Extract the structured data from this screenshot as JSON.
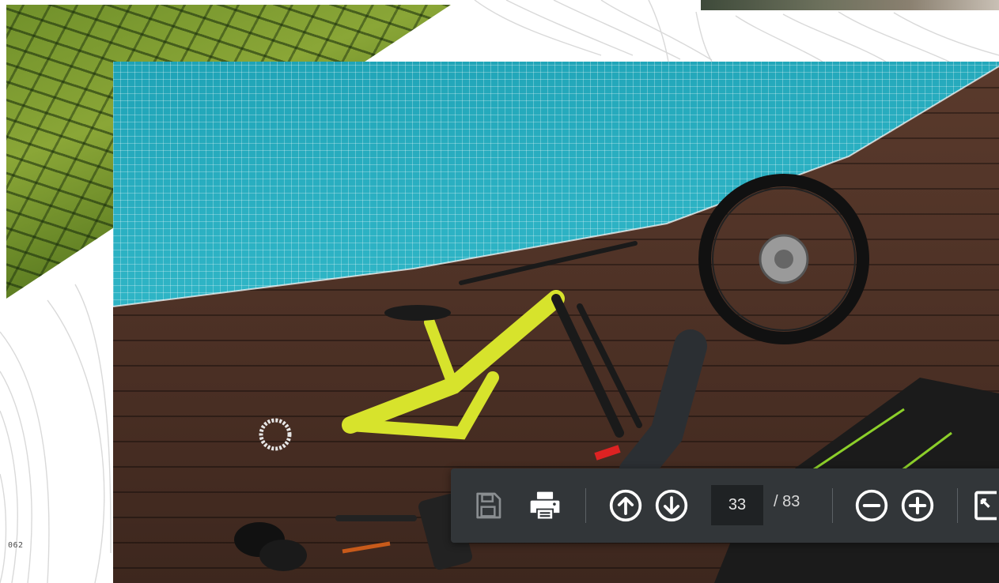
{
  "document": {
    "page_number_label": "062"
  },
  "toolbar": {
    "current_page": "33",
    "total_pages": "/ 83",
    "icons": {
      "save": "save-icon",
      "print": "print-icon",
      "previous_page": "arrow-up-circle-icon",
      "next_page": "arrow-down-circle-icon",
      "zoom_out": "minus-circle-icon",
      "zoom_in": "plus-circle-icon",
      "fit": "fit-page-icon"
    },
    "colors": {
      "background": "#323639",
      "icon": "#ffffff",
      "icon_disabled": "#8a8e91"
    }
  }
}
